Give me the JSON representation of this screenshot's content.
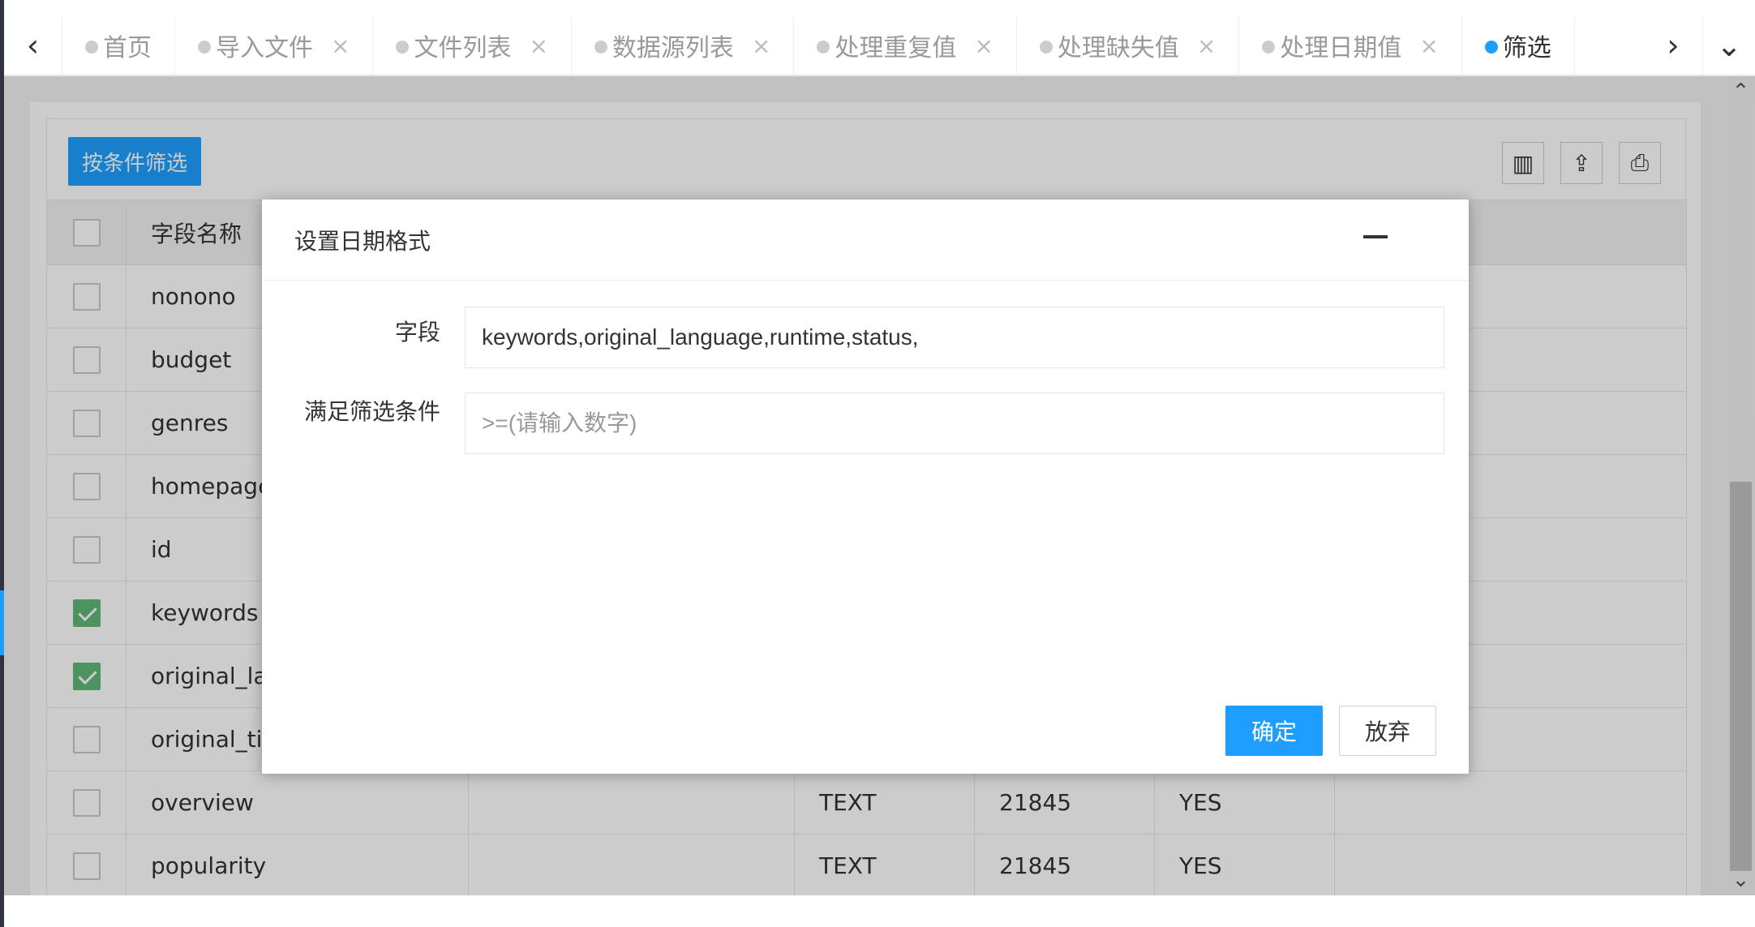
{
  "tabs": [
    {
      "label": "首页",
      "closable": false
    },
    {
      "label": "导入文件",
      "closable": true
    },
    {
      "label": "文件列表",
      "closable": true
    },
    {
      "label": "数据源列表",
      "closable": true
    },
    {
      "label": "处理重复值",
      "closable": true
    },
    {
      "label": "处理缺失值",
      "closable": true
    },
    {
      "label": "处理日期值",
      "closable": true
    },
    {
      "label": "筛选",
      "closable": false,
      "active": true
    }
  ],
  "icons": {
    "prev": "‹",
    "next": "›",
    "menu": "⌄",
    "close": "×",
    "columns": "▥",
    "export": "⇪",
    "print": "⎙",
    "scroll_up": "⌃",
    "scroll_down": "⌄"
  },
  "toolbar": {
    "filter_button": "按条件筛选"
  },
  "table": {
    "header": {
      "field_name": "字段名称"
    },
    "rows": [
      {
        "checked": false,
        "name": "nonono",
        "a": "",
        "type": "",
        "count": "",
        "flag": ""
      },
      {
        "checked": false,
        "name": "budget",
        "a": "",
        "type": "",
        "count": "",
        "flag": ""
      },
      {
        "checked": false,
        "name": "genres",
        "a": "",
        "type": "",
        "count": "",
        "flag": ""
      },
      {
        "checked": false,
        "name": "homepage",
        "a": "",
        "type": "",
        "count": "",
        "flag": ""
      },
      {
        "checked": false,
        "name": "id",
        "a": "",
        "type": "",
        "count": "",
        "flag": ""
      },
      {
        "checked": true,
        "name": "keywords",
        "a": "",
        "type": "",
        "count": "",
        "flag": ""
      },
      {
        "checked": true,
        "name": "original_language",
        "a": "",
        "type": "",
        "count": "",
        "flag": ""
      },
      {
        "checked": false,
        "name": "original_title",
        "a": "",
        "type": "",
        "count": "",
        "flag": ""
      },
      {
        "checked": false,
        "name": "overview",
        "a": "",
        "type": "TEXT",
        "count": "21845",
        "flag": "YES"
      },
      {
        "checked": false,
        "name": "popularity",
        "a": "",
        "type": "TEXT",
        "count": "21845",
        "flag": "YES"
      }
    ]
  },
  "dialog": {
    "title": "设置日期格式",
    "field_label": "字段",
    "field_value": "keywords,original_language,runtime,status,",
    "condition_label": "满足筛选条件",
    "condition_placeholder": ">=(请输入数字)",
    "confirm": "确定",
    "cancel": "放弃"
  },
  "colors": {
    "primary": "#1e9fff",
    "checked": "#5fb878",
    "overlay": "rgba(0,0,0,0.2)"
  }
}
